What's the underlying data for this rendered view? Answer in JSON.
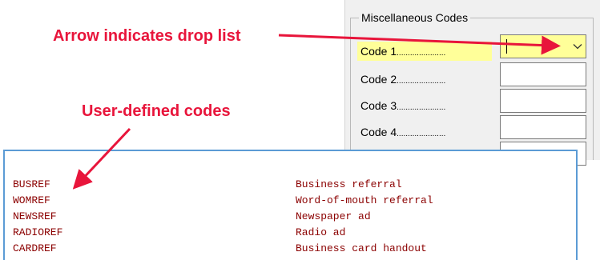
{
  "group": {
    "title": "Miscellaneous Codes",
    "fields": [
      {
        "label": "Code 1",
        "dots": "......................",
        "value": "",
        "type": "dropdown",
        "highlighted": true
      },
      {
        "label": "Code 2",
        "dots": "......................",
        "value": "",
        "type": "text",
        "highlighted": false
      },
      {
        "label": "Code 3",
        "dots": "......................",
        "value": "",
        "type": "text",
        "highlighted": false
      },
      {
        "label": "Code 4",
        "dots": "......................",
        "value": "",
        "type": "text",
        "highlighted": false
      },
      {
        "label": "",
        "dots": "",
        "value": "",
        "type": "text",
        "highlighted": false
      }
    ]
  },
  "annotations": {
    "dropdown_note": "Arrow indicates drop list",
    "codes_note": "User-defined codes"
  },
  "listing": {
    "rows": [
      {
        "code": "BUSREF",
        "description": "Business referral"
      },
      {
        "code": "WOMREF",
        "description": "Word-of-mouth referral"
      },
      {
        "code": "NEWSREF",
        "description": "Newspaper ad"
      },
      {
        "code": "RADIOREF",
        "description": "Radio ad"
      },
      {
        "code": "CARDREF",
        "description": "Business card handout"
      }
    ]
  },
  "colors": {
    "annotation": "#e8153b",
    "highlight": "#ffff99",
    "listing_text": "#8b0000",
    "listing_border": "#5b9bd5",
    "panel_bg": "#f0f0f0"
  },
  "icons": {
    "dropdown": "chevron-down-icon"
  }
}
